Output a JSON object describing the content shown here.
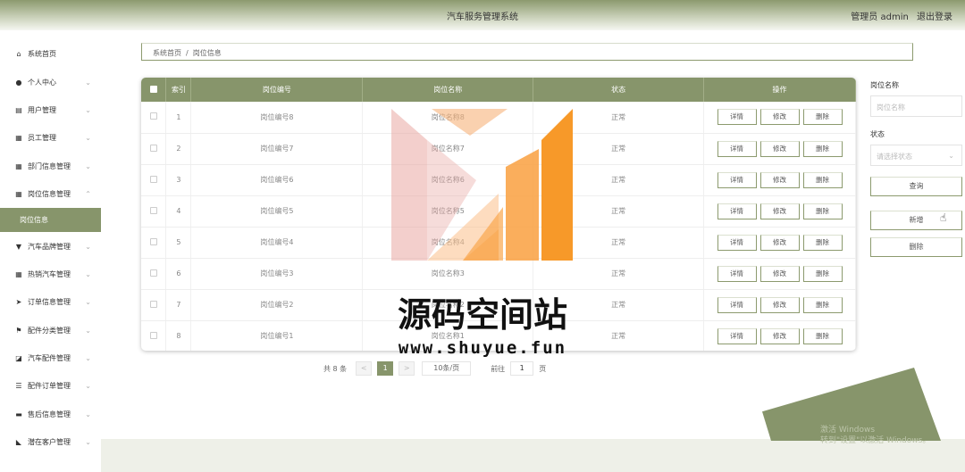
{
  "header": {
    "title": "汽车服务管理系统",
    "user": "管理员 admin",
    "logout": "退出登录"
  },
  "sidebar": {
    "items": [
      {
        "label": "系统首页",
        "icon": "home-icon",
        "expandable": false
      },
      {
        "label": "个人中心",
        "icon": "user-icon",
        "expandable": true
      },
      {
        "label": "用户管理",
        "icon": "clipboard-icon",
        "expandable": true
      },
      {
        "label": "员工管理",
        "icon": "grid-icon",
        "expandable": true
      },
      {
        "label": "部门信息管理",
        "icon": "grid-icon",
        "expandable": true
      },
      {
        "label": "岗位信息管理",
        "icon": "grid-icon",
        "expandable": true,
        "expanded": true
      }
    ],
    "active_sub": "岗位信息",
    "items_after": [
      {
        "label": "汽车品牌管理",
        "icon": "trophy-icon"
      },
      {
        "label": "热销汽车管理",
        "icon": "grid-icon"
      },
      {
        "label": "订单信息管理",
        "icon": "send-icon"
      },
      {
        "label": "配件分类管理",
        "icon": "flag-icon"
      },
      {
        "label": "汽车配件管理",
        "icon": "chart-icon"
      },
      {
        "label": "配件订单管理",
        "icon": "list-icon"
      },
      {
        "label": "售后信息管理",
        "icon": "chat-icon"
      },
      {
        "label": "潜在客户管理",
        "icon": "bookmark-icon"
      }
    ]
  },
  "breadcrumb": {
    "home": "系统首页",
    "current": "岗位信息"
  },
  "table": {
    "headers": [
      "索引",
      "岗位编号",
      "岗位名称",
      "状态",
      "操作"
    ],
    "rows": [
      {
        "index": "1",
        "code": "岗位编号8",
        "name": "岗位名称8",
        "status": "正常"
      },
      {
        "index": "2",
        "code": "岗位编号7",
        "name": "岗位名称7",
        "status": "正常"
      },
      {
        "index": "3",
        "code": "岗位编号6",
        "name": "岗位名称6",
        "status": "正常"
      },
      {
        "index": "4",
        "code": "岗位编号5",
        "name": "岗位名称5",
        "status": "正常"
      },
      {
        "index": "5",
        "code": "岗位编号4",
        "name": "岗位名称4",
        "status": "正常"
      },
      {
        "index": "6",
        "code": "岗位编号3",
        "name": "岗位名称3",
        "status": "正常"
      },
      {
        "index": "7",
        "code": "岗位编号2",
        "name": "岗位名称2",
        "status": "正常"
      },
      {
        "index": "8",
        "code": "岗位编号1",
        "name": "岗位名称1",
        "status": "正常"
      }
    ],
    "actions": {
      "detail": "详情",
      "edit": "修改",
      "delete": "删除"
    }
  },
  "pagination": {
    "total": "共 8 条",
    "prev": "<",
    "current": "1",
    "next": ">",
    "page_size": "10条/页",
    "goto_label": "前往",
    "goto_value": "1",
    "page_unit": "页"
  },
  "search": {
    "name_label": "岗位名称",
    "name_placeholder": "岗位名称",
    "status_label": "状态",
    "status_placeholder": "请选择状态",
    "query_button": "查询",
    "add_button": "新增",
    "delete_button": "删除"
  },
  "watermark": {
    "text": "源码空间站",
    "url": "www.shuyue.fun"
  },
  "windows_notice": {
    "line1": "激活 Windows",
    "line2": "转到\"设置\"以激活 Windows。"
  },
  "colors": {
    "accent": "#87956b",
    "watermark_orange": "#f7931e"
  }
}
